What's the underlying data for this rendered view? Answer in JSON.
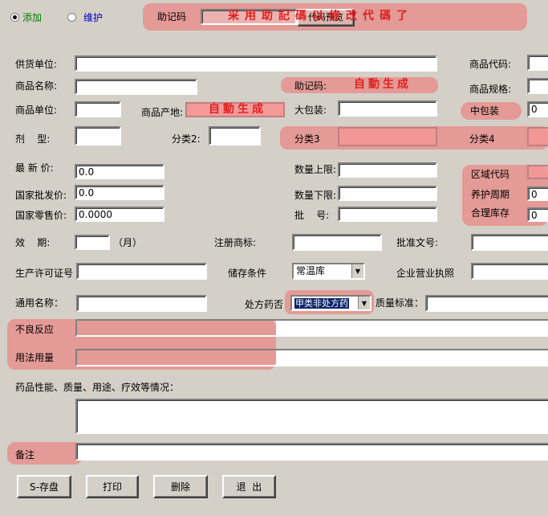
{
  "mode": {
    "add_label": "添加",
    "maintain_label": "维护"
  },
  "top": {
    "code_label": "助记码",
    "code_preview_button": "代码预览",
    "note": "采用助記碼以修改代碼了"
  },
  "labels": {
    "supplier": "供货单位:",
    "product_code": "商品代码:",
    "product_name": "商品名称:",
    "mnemonic": "助记码:",
    "spec": "商品规格:",
    "unit": "商品单位:",
    "origin": "商品产地:",
    "big_pack": "大包装:",
    "mid_pack": "中包装",
    "dosage": "剂    型:",
    "cat2": "分类2:",
    "cat3": "分类3",
    "cat4": "分类4",
    "latest_price": "最 新 价:",
    "qty_upper": "数量上限:",
    "region_code": "区域代码",
    "wholesale_price": "国家批发价:",
    "qty_lower": "数量下限:",
    "maint_period": "养护周期",
    "retail_price": "国家零售价:",
    "batch_no": "批    号:",
    "reasonable_stock": "合理库存",
    "validity": "效    期:",
    "month_unit": "（月）",
    "trademark": "注册商标:",
    "approval_no": "批准文号:",
    "license": "生产许可证号",
    "storage": "储存条件",
    "business_license": "企业营业执照",
    "generic_name": "通用名称：",
    "prescription": "处方药否",
    "quality_std": "质量标准：",
    "adverse": "不良反应",
    "usage": "用法用量",
    "description": "药品性能、质量、用途、疗效等情况：",
    "remark": "备注"
  },
  "values": {
    "auto_gen_mnemonic": "自動生成",
    "auto_gen_origin": "自動生成",
    "mid_pack": "0",
    "latest_price": "0.0",
    "wholesale_price": "0.0",
    "retail_price": "0.0000",
    "maint_period": "0",
    "reasonable_stock": "0",
    "storage": "常温库",
    "prescription": "甲类非处方药"
  },
  "buttons": {
    "save": "S-存盘",
    "print": "打印",
    "delete": "删除",
    "exit": "退  出"
  },
  "colors": {
    "highlight": "#f06e6e",
    "stamp": "#e02020",
    "background": "#d4d0c8"
  }
}
